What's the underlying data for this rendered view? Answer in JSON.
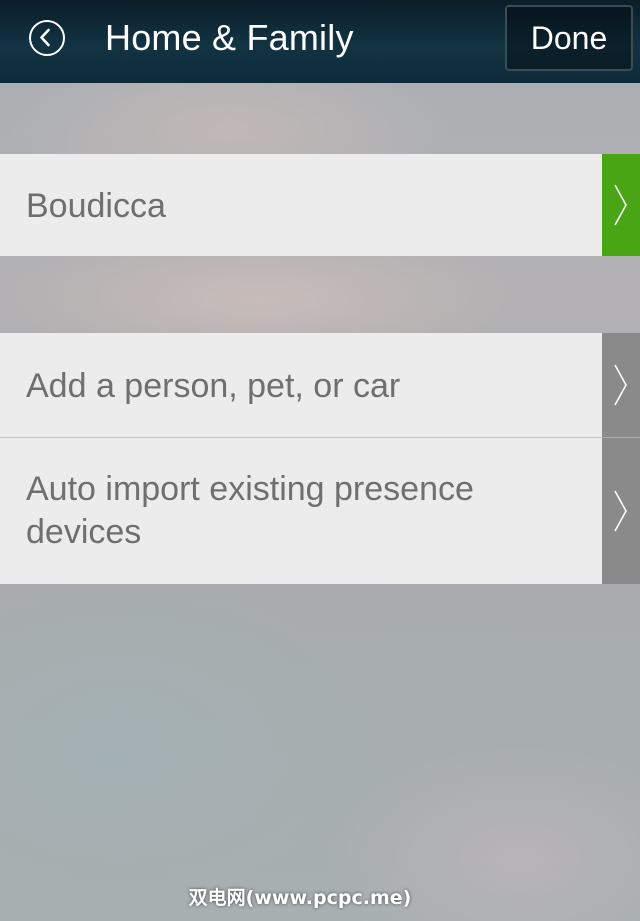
{
  "header": {
    "title": "Home & Family",
    "done_label": "Done",
    "back_icon": "back-arrow-circle-icon"
  },
  "rows": [
    {
      "label": "Boudicca",
      "chevron_color": "#4aa514"
    },
    {
      "label": "Add a person, pet, or car",
      "chevron_color": "#8a8a8a"
    },
    {
      "label": "Auto import existing presence devices",
      "chevron_color": "#8a8a8a"
    }
  ],
  "watermark": "双电网(www.pcpc.me)"
}
